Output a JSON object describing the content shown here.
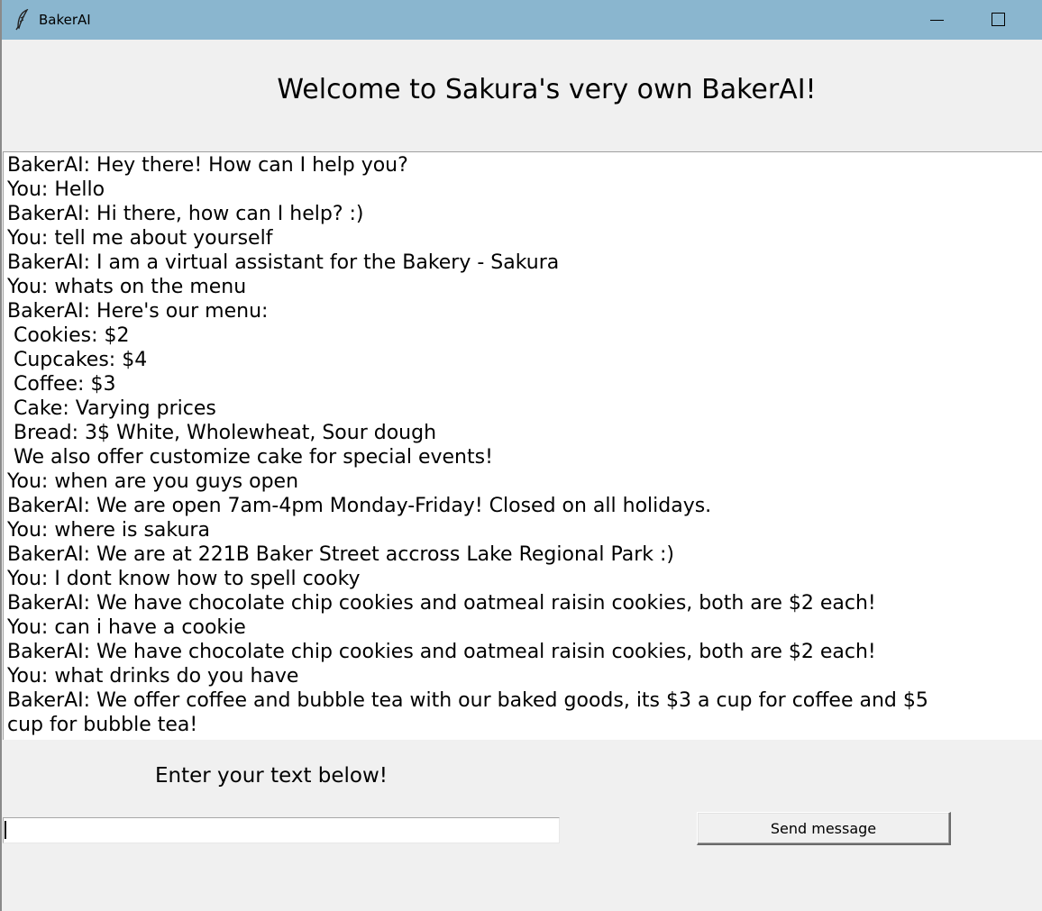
{
  "window": {
    "title": "BakerAI",
    "icon": "feather-icon",
    "controls": [
      "minimize-icon",
      "maximize-icon"
    ],
    "titlebar_color": "#8ab6cf"
  },
  "heading": "Welcome to Sakura's very own BakerAI!",
  "chat": {
    "lines": [
      "BakerAI: Hey there! How can I help you?",
      "You: Hello",
      "BakerAI: Hi there, how can I help? :)",
      "You: tell me about yourself",
      "BakerAI: I am a virtual assistant for the Bakery - Sakura",
      "You: whats on the menu",
      "BakerAI: Here's our menu:",
      " Cookies: $2",
      " Cupcakes: $4",
      " Coffee: $3",
      " Cake: Varying prices",
      " Bread: 3$ White, Wholewheat, Sour dough",
      " We also offer customize cake for special events!",
      "You: when are you guys open",
      "BakerAI: We are open 7am-4pm Monday-Friday! Closed on all holidays.",
      "You: where is sakura",
      "BakerAI: We are at 221B Baker Street accross Lake Regional Park :)",
      "You: I dont know how to spell cooky",
      "BakerAI: We have chocolate chip cookies and oatmeal raisin cookies, both are $2 each!",
      "You: can i have a cookie",
      "BakerAI: We have chocolate chip cookies and oatmeal raisin cookies, both are $2 each!",
      "You: what drinks do you have",
      "BakerAI: We offer coffee and bubble tea with our baked goods, its $3 a cup for coffee and $5",
      "cup for bubble tea!"
    ]
  },
  "input": {
    "prompt_label": "Enter your text below!",
    "value": "",
    "send_label": "Send message"
  }
}
